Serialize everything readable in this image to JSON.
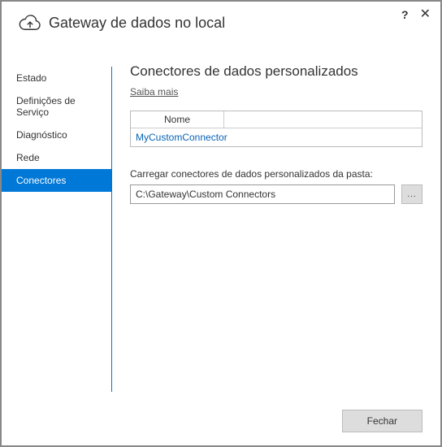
{
  "window": {
    "title": "Gateway de dados no local",
    "help_label": "?",
    "close_label": "✕"
  },
  "sidebar": {
    "items": [
      {
        "label": "Estado"
      },
      {
        "label": "Definições de Serviço"
      },
      {
        "label": "Diagnóstico"
      },
      {
        "label": "Rede"
      },
      {
        "label": "Conectores"
      }
    ]
  },
  "content": {
    "section_title": "Conectores de dados personalizados",
    "learn_more": "Saiba mais",
    "table": {
      "header_name": "Nome",
      "rows": [
        {
          "name": "MyCustomConnector"
        }
      ]
    },
    "load_label": "Carregar conectores de dados personalizados da pasta:",
    "path_value": "C:\\Gateway\\Custom Connectors",
    "browse_label": "..."
  },
  "footer": {
    "close_label": "Fechar"
  }
}
